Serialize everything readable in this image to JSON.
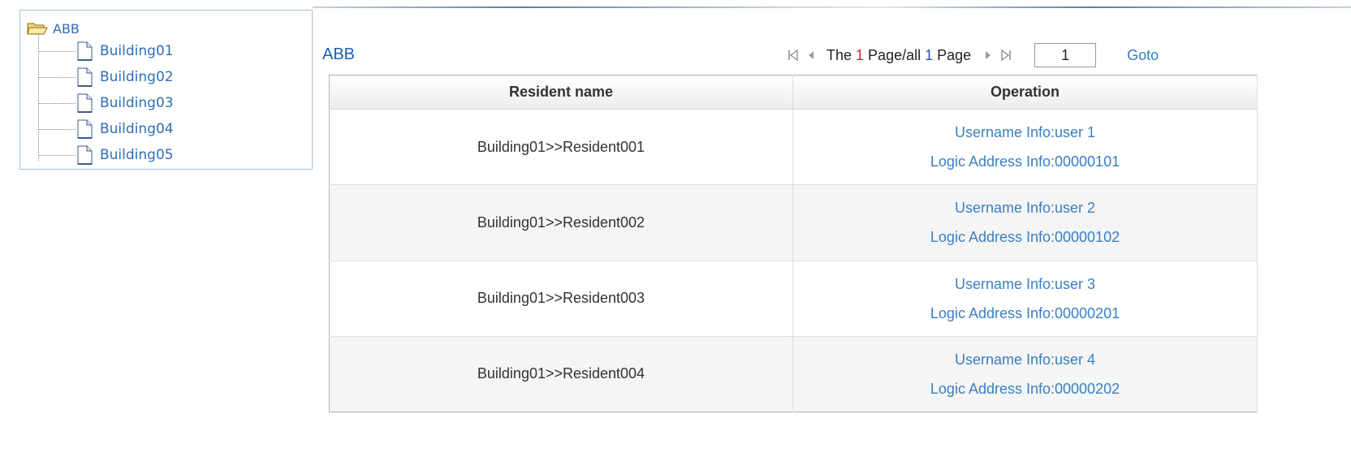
{
  "tree": {
    "root_label": "ABB",
    "items": [
      {
        "label": "Building01"
      },
      {
        "label": "Building02"
      },
      {
        "label": "Building03"
      },
      {
        "label": "Building04"
      },
      {
        "label": "Building05"
      }
    ]
  },
  "content": {
    "title": "ABB"
  },
  "pager": {
    "text_prefix": "The ",
    "current_page": "1",
    "text_middle": " Page/all ",
    "total_pages": "1",
    "text_suffix": " Page",
    "input_value": "1",
    "goto_label": "Goto"
  },
  "table": {
    "headers": [
      "Resident name",
      "Operation"
    ],
    "rows": [
      {
        "name": "Building01>>Resident001",
        "username": "Username Info:user 1",
        "address": "Logic Address Info:00000101"
      },
      {
        "name": "Building01>>Resident002",
        "username": "Username Info:user 2",
        "address": "Logic Address Info:00000102"
      },
      {
        "name": "Building01>>Resident003",
        "username": "Username Info:user 3",
        "address": "Logic Address Info:00000201"
      },
      {
        "name": "Building01>>Resident004",
        "username": "Username Info:user 4",
        "address": "Logic Address Info:00000202"
      }
    ]
  },
  "colors": {
    "link": "#3a7fc0",
    "title": "#1f5fb0",
    "current_page": "#d7261e",
    "total_pages": "#2f4fd1"
  }
}
